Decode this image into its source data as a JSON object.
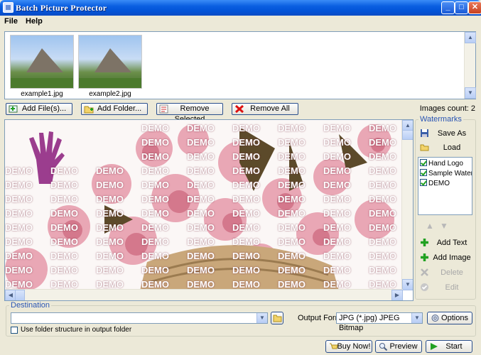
{
  "window": {
    "title": "Batch Picture Protector"
  },
  "menu": {
    "file": "File",
    "help": "Help"
  },
  "thumbnails": [
    {
      "caption": "example1.jpg"
    },
    {
      "caption": "example2.jpg"
    }
  ],
  "toolbar": {
    "add_files": "Add File(s)...",
    "add_folder": "Add Folder...",
    "remove_selected": "Remove Selected",
    "remove_all": "Remove All",
    "images_count": "Images count: 2"
  },
  "preview": {
    "watermark_text": "DEMO"
  },
  "watermarks": {
    "legend": "Watermarks",
    "save_as": "Save As",
    "load": "Load",
    "items": [
      {
        "label": "Hand Logo",
        "checked": true
      },
      {
        "label": "Sample Watermark",
        "checked": true
      },
      {
        "label": "DEMO",
        "checked": true
      }
    ],
    "add_text": "Add Text",
    "add_image": "Add Image",
    "delete": "Delete",
    "edit": "Edit"
  },
  "destination": {
    "legend": "Destination",
    "path_value": "",
    "output_format_label": "Output Format",
    "output_format_value": "JPG (*.jpg) JPEG Bitmap",
    "options": "Options",
    "use_folder_structure": "Use folder structure in output folder"
  },
  "footer": {
    "buy_now": "Buy Now!",
    "preview": "Preview",
    "start": "Start"
  },
  "colors": {
    "title_blue": "#0a5ee0",
    "legend_blue": "#2a55b4",
    "accent_green": "#21a121"
  }
}
